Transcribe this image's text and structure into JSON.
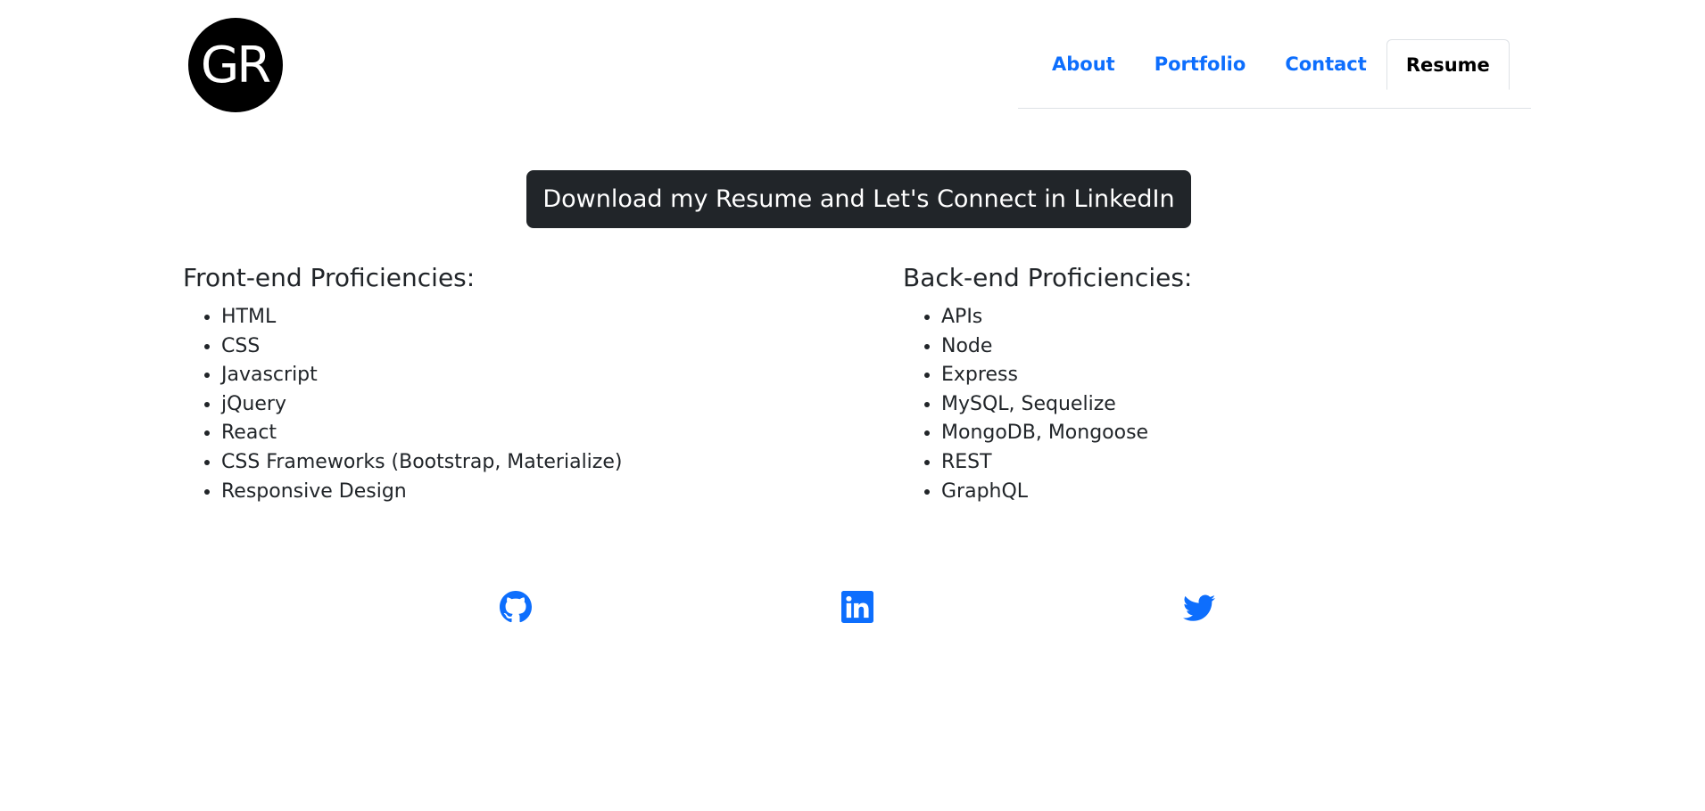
{
  "logo": {
    "text": "GR"
  },
  "nav": {
    "items": [
      {
        "label": "About"
      },
      {
        "label": "Portfolio"
      },
      {
        "label": "Contact"
      },
      {
        "label": "Resume"
      }
    ],
    "active": "Resume"
  },
  "main": {
    "download_button": "Download my Resume and Let's Connect in LinkedIn",
    "frontend": {
      "heading": "Front-end Proficiencies:",
      "items": [
        "HTML",
        "CSS",
        "Javascript",
        "jQuery",
        "React",
        "CSS Frameworks (Bootstrap, Materialize)",
        "Responsive Design"
      ]
    },
    "backend": {
      "heading": "Back-end Proficiencies:",
      "items": [
        "APIs",
        "Node",
        "Express",
        "MySQL, Sequelize",
        "MongoDB, Mongoose",
        "REST",
        "GraphQL"
      ]
    }
  },
  "social": {
    "icons": [
      "github-icon",
      "linkedin-icon",
      "twitter-icon"
    ]
  },
  "colors": {
    "link": "#0d6efd",
    "button_bg": "#212529",
    "text": "#212529",
    "logo_bg": "#000000",
    "icon": "#0d6efd"
  }
}
